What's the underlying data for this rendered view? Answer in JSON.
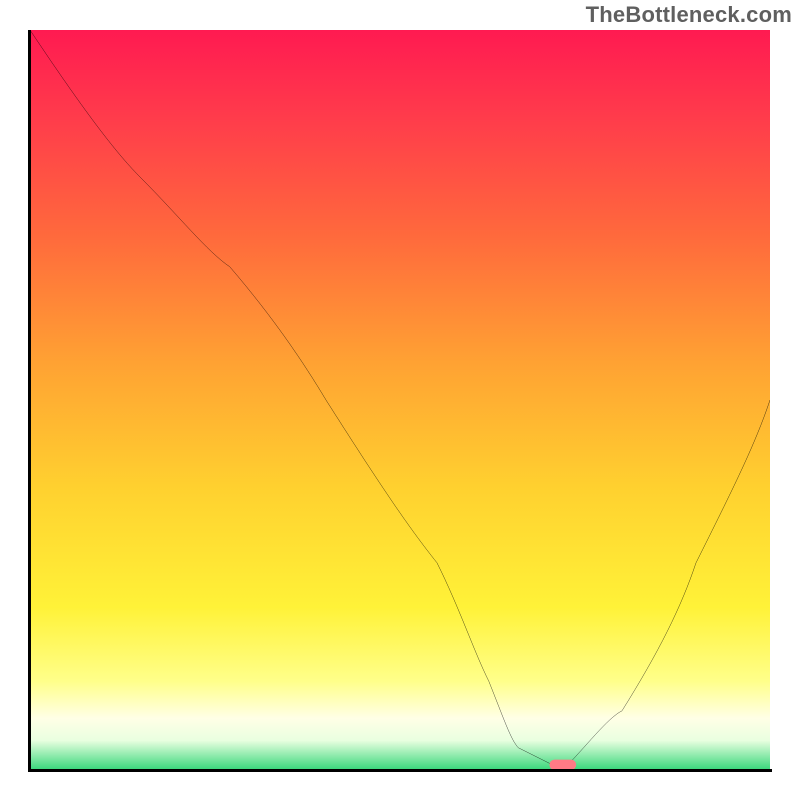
{
  "watermark": "TheBottleneck.com",
  "chart_data": {
    "type": "line",
    "title": "",
    "xlabel": "",
    "ylabel": "",
    "xlim": [
      0,
      100
    ],
    "ylim": [
      0,
      100
    ],
    "grid": false,
    "legend": false,
    "background_gradient": {
      "direction": "vertical",
      "stops": [
        {
          "pos": 0.0,
          "color": "#ff1a51"
        },
        {
          "pos": 0.12,
          "color": "#ff3c4b"
        },
        {
          "pos": 0.28,
          "color": "#ff6a3c"
        },
        {
          "pos": 0.45,
          "color": "#ffa233"
        },
        {
          "pos": 0.62,
          "color": "#ffd12f"
        },
        {
          "pos": 0.78,
          "color": "#fff238"
        },
        {
          "pos": 0.88,
          "color": "#ffff8a"
        },
        {
          "pos": 0.93,
          "color": "#ffffe6"
        },
        {
          "pos": 0.96,
          "color": "#e9ffe0"
        },
        {
          "pos": 1.0,
          "color": "#37d77a"
        }
      ]
    },
    "series": [
      {
        "name": "bottleneck-curve",
        "x": [
          0,
          15,
          27,
          40,
          55,
          62,
          66,
          72,
          80,
          90,
          100
        ],
        "y": [
          100,
          80,
          68,
          50,
          28,
          12,
          3,
          0,
          8,
          28,
          50
        ]
      }
    ],
    "marker": {
      "name": "optimal-point",
      "x": 72,
      "y": 0,
      "color": "#ff7a85"
    }
  }
}
